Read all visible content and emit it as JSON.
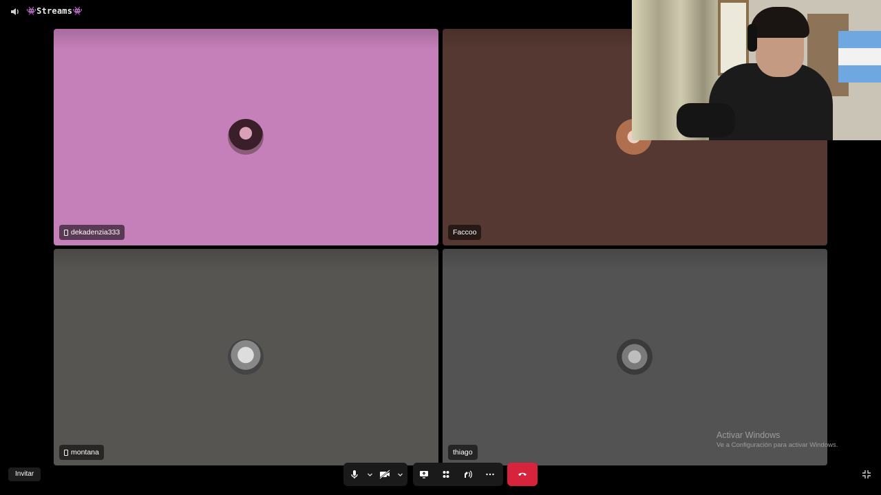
{
  "channel": {
    "name": "👾Streams👾"
  },
  "tiles": [
    {
      "name": "dekadenzia333",
      "on_mobile": true,
      "color": "#c57fb9"
    },
    {
      "name": "Faccoo",
      "on_mobile": false,
      "color": "#553831"
    },
    {
      "name": "montana",
      "on_mobile": true,
      "color": "#575552"
    },
    {
      "name": "thiago",
      "on_mobile": false,
      "color": "#535353"
    }
  ],
  "controls": {
    "invite_label": "Invitar",
    "buttons": [
      "microphone-icon",
      "chevron-down-icon",
      "camera-off-icon",
      "chevron-down-icon",
      "screen-share-icon",
      "activities-icon",
      "soundboard-icon",
      "more-icon",
      "hang-up-icon"
    ],
    "end_call_color": "#d8233c"
  },
  "watermark": {
    "line1": "Activar Windows",
    "line2": "Ve a Configuración para activar Windows."
  }
}
